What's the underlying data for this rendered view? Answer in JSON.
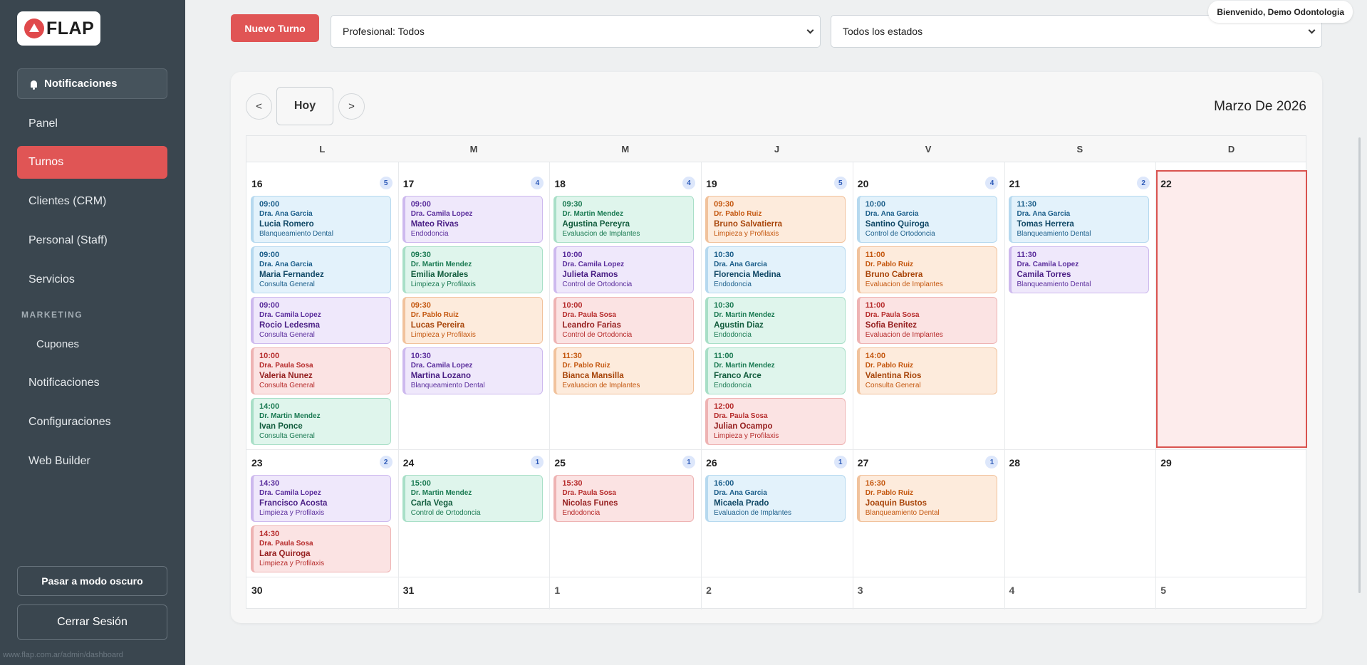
{
  "sidebar": {
    "logo_text": "FLAP",
    "notifications_button": "Notificaciones",
    "items": [
      {
        "label": "Panel",
        "active": false
      },
      {
        "label": "Turnos",
        "active": true
      },
      {
        "label": "Clientes (CRM)",
        "active": false
      },
      {
        "label": "Personal (Staff)",
        "active": false
      },
      {
        "label": "Servicios",
        "active": false
      }
    ],
    "section_label": "MARKETING",
    "sub_item": "Cupones",
    "items_after": [
      {
        "label": "Notificaciones"
      },
      {
        "label": "Configuraciones"
      },
      {
        "label": "Web Builder"
      }
    ],
    "dark_mode_button": "Pasar a modo oscuro",
    "logout_button": "Cerrar Sesión",
    "status_url": "www.flap.com.ar/admin/dashboard"
  },
  "topbar": {
    "new_button": "Nuevo Turno",
    "professional_select": "Profesional: Todos",
    "status_select": "Todos los estados",
    "welcome": "Bienvenido, Demo Odontologia"
  },
  "calendar": {
    "prev": "<",
    "today": "Hoy",
    "next": ">",
    "month_title": "Marzo De 2026",
    "weekdays": [
      "L",
      "M",
      "M",
      "J",
      "V",
      "S",
      "D"
    ],
    "weeks": [
      {
        "days": [
          {
            "num": "16",
            "count": "5",
            "appts": [
              {
                "time": "09:00",
                "doctor": "Dra. Ana Garcia",
                "patient": "Lucia Romero",
                "service": "Blanqueamiento Dental",
                "color": "blue"
              },
              {
                "time": "09:00",
                "doctor": "Dra. Ana Garcia",
                "patient": "Maria Fernandez",
                "service": "Consulta General",
                "color": "blue"
              },
              {
                "time": "09:00",
                "doctor": "Dra. Camila Lopez",
                "patient": "Rocio Ledesma",
                "service": "Consulta General",
                "color": "purple"
              },
              {
                "time": "10:00",
                "doctor": "Dra. Paula Sosa",
                "patient": "Valeria Nunez",
                "service": "Consulta General",
                "color": "red"
              },
              {
                "time": "14:00",
                "doctor": "Dr. Martin Mendez",
                "patient": "Ivan Ponce",
                "service": "Consulta General",
                "color": "green"
              }
            ]
          },
          {
            "num": "17",
            "count": "4",
            "appts": [
              {
                "time": "09:00",
                "doctor": "Dra. Camila Lopez",
                "patient": "Mateo Rivas",
                "service": "Endodoncia",
                "color": "purple"
              },
              {
                "time": "09:30",
                "doctor": "Dr. Martin Mendez",
                "patient": "Emilia Morales",
                "service": "Limpieza y Profilaxis",
                "color": "green"
              },
              {
                "time": "09:30",
                "doctor": "Dr. Pablo Ruiz",
                "patient": "Lucas Pereira",
                "service": "Limpieza y Profilaxis",
                "color": "orange"
              },
              {
                "time": "10:30",
                "doctor": "Dra. Camila Lopez",
                "patient": "Martina Lozano",
                "service": "Blanqueamiento Dental",
                "color": "purple"
              }
            ]
          },
          {
            "num": "18",
            "count": "4",
            "appts": [
              {
                "time": "09:30",
                "doctor": "Dr. Martin Mendez",
                "patient": "Agustina Pereyra",
                "service": "Evaluacion de Implantes",
                "color": "green"
              },
              {
                "time": "10:00",
                "doctor": "Dra. Camila Lopez",
                "patient": "Julieta Ramos",
                "service": "Control de Ortodoncia",
                "color": "purple"
              },
              {
                "time": "10:00",
                "doctor": "Dra. Paula Sosa",
                "patient": "Leandro Farias",
                "service": "Control de Ortodoncia",
                "color": "red"
              },
              {
                "time": "11:30",
                "doctor": "Dr. Pablo Ruiz",
                "patient": "Bianca Mansilla",
                "service": "Evaluacion de Implantes",
                "color": "orange"
              }
            ]
          },
          {
            "num": "19",
            "count": "5",
            "appts": [
              {
                "time": "09:30",
                "doctor": "Dr. Pablo Ruiz",
                "patient": "Bruno Salvatierra",
                "service": "Limpieza y Profilaxis",
                "color": "orange"
              },
              {
                "time": "10:30",
                "doctor": "Dra. Ana Garcia",
                "patient": "Florencia Medina",
                "service": "Endodoncia",
                "color": "blue"
              },
              {
                "time": "10:30",
                "doctor": "Dr. Martin Mendez",
                "patient": "Agustin Diaz",
                "service": "Endodoncia",
                "color": "green"
              },
              {
                "time": "11:00",
                "doctor": "Dr. Martin Mendez",
                "patient": "Franco Arce",
                "service": "Endodoncia",
                "color": "green"
              },
              {
                "time": "12:00",
                "doctor": "Dra. Paula Sosa",
                "patient": "Julian Ocampo",
                "service": "Limpieza y Profilaxis",
                "color": "red"
              }
            ]
          },
          {
            "num": "20",
            "count": "4",
            "appts": [
              {
                "time": "10:00",
                "doctor": "Dra. Ana Garcia",
                "patient": "Santino Quiroga",
                "service": "Control de Ortodoncia",
                "color": "blue"
              },
              {
                "time": "11:00",
                "doctor": "Dr. Pablo Ruiz",
                "patient": "Bruno Cabrera",
                "service": "Evaluacion de Implantes",
                "color": "orange"
              },
              {
                "time": "11:00",
                "doctor": "Dra. Paula Sosa",
                "patient": "Sofia Benitez",
                "service": "Evaluacion de Implantes",
                "color": "red"
              },
              {
                "time": "14:00",
                "doctor": "Dr. Pablo Ruiz",
                "patient": "Valentina Rios",
                "service": "Consulta General",
                "color": "orange"
              }
            ]
          },
          {
            "num": "21",
            "count": "2",
            "appts": [
              {
                "time": "11:30",
                "doctor": "Dra. Ana Garcia",
                "patient": "Tomas Herrera",
                "service": "Blanqueamiento Dental",
                "color": "blue"
              },
              {
                "time": "11:30",
                "doctor": "Dra. Camila Lopez",
                "patient": "Camila Torres",
                "service": "Blanqueamiento Dental",
                "color": "purple"
              }
            ]
          },
          {
            "num": "22",
            "count": "",
            "today": true,
            "appts": []
          }
        ]
      },
      {
        "days": [
          {
            "num": "23",
            "count": "2",
            "appts": [
              {
                "time": "14:30",
                "doctor": "Dra. Camila Lopez",
                "patient": "Francisco Acosta",
                "service": "Limpieza y Profilaxis",
                "color": "purple"
              },
              {
                "time": "14:30",
                "doctor": "Dra. Paula Sosa",
                "patient": "Lara Quiroga",
                "service": "Limpieza y Profilaxis",
                "color": "red"
              }
            ]
          },
          {
            "num": "24",
            "count": "1",
            "appts": [
              {
                "time": "15:00",
                "doctor": "Dr. Martin Mendez",
                "patient": "Carla Vega",
                "service": "Control de Ortodoncia",
                "color": "green"
              }
            ]
          },
          {
            "num": "25",
            "count": "1",
            "appts": [
              {
                "time": "15:30",
                "doctor": "Dra. Paula Sosa",
                "patient": "Nicolas Funes",
                "service": "Endodoncia",
                "color": "red"
              }
            ]
          },
          {
            "num": "26",
            "count": "1",
            "appts": [
              {
                "time": "16:00",
                "doctor": "Dra. Ana Garcia",
                "patient": "Micaela Prado",
                "service": "Evaluacion de Implantes",
                "color": "blue"
              }
            ]
          },
          {
            "num": "27",
            "count": "1",
            "appts": [
              {
                "time": "16:30",
                "doctor": "Dr. Pablo Ruiz",
                "patient": "Joaquin Bustos",
                "service": "Blanqueamiento Dental",
                "color": "orange"
              }
            ]
          },
          {
            "num": "28",
            "count": "",
            "appts": []
          },
          {
            "num": "29",
            "count": "",
            "appts": []
          }
        ]
      },
      {
        "days": [
          {
            "num": "30",
            "count": "",
            "appts": []
          },
          {
            "num": "31",
            "count": "",
            "appts": []
          },
          {
            "num": "1",
            "count": "",
            "other": true,
            "appts": []
          },
          {
            "num": "2",
            "count": "",
            "other": true,
            "appts": []
          },
          {
            "num": "3",
            "count": "",
            "other": true,
            "appts": []
          },
          {
            "num": "4",
            "count": "",
            "other": true,
            "appts": []
          },
          {
            "num": "5",
            "count": "",
            "other": true,
            "appts": []
          }
        ]
      }
    ]
  }
}
